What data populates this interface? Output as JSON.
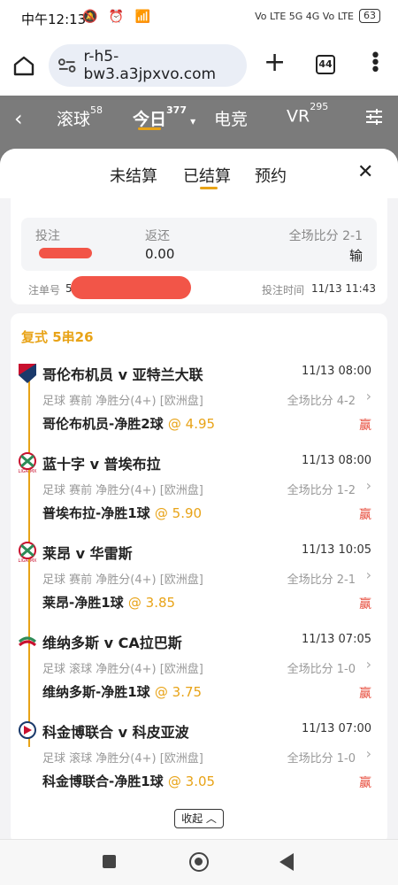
{
  "status_bar": {
    "time": "中午12:13",
    "icons": "🔕 ⏰ 📶",
    "network": "Vo LTE 5G 4G Vo LTE",
    "battery": "63"
  },
  "browser": {
    "url": "r-h5-bw3.a3jpxvo.com",
    "tabs_count": "44",
    "plus": "+",
    "menu": "⋮"
  },
  "app_nav": {
    "back": "‹",
    "items": [
      {
        "label": "滚球",
        "count": "58"
      },
      {
        "label": "今日",
        "count": "377"
      },
      {
        "label": "电竞",
        "count": ""
      },
      {
        "label": "VR",
        "count": "295"
      }
    ]
  },
  "sheet": {
    "tabs": [
      "未结算",
      "已结算",
      "预约"
    ],
    "close": "✕"
  },
  "summary": {
    "bet_label": "投注",
    "return_label": "返还",
    "return_value": "0.00",
    "score_label": "全场比分 2-1",
    "result": "输",
    "order_label": "注单号",
    "order_prefix": "50",
    "bet_time_label": "投注时间",
    "bet_time": "11/13 11:43"
  },
  "detail": {
    "title": "复式 5串26",
    "collapse": "收起 ︿",
    "matches": [
      {
        "teams": "哥伦布机员 v 亚特兰大联",
        "time": "11/13 08:00",
        "info": "足球 赛前   净胜分(4+) [欧洲盘]",
        "score": "全场比分 4-2",
        "pick": "哥伦布机员-净胜2球",
        "odds": "@ 4.95",
        "result": "赢"
      },
      {
        "teams": "蓝十字 v 普埃布拉",
        "time": "11/13 08:00",
        "info": "足球 赛前   净胜分(4+) [欧洲盘]",
        "score": "全场比分 1-2",
        "pick": "普埃布拉-净胜1球",
        "odds": "@ 5.90",
        "result": "赢"
      },
      {
        "teams": "莱昂 v 华雷斯",
        "time": "11/13 10:05",
        "info": "足球 赛前   净胜分(4+) [欧洲盘]",
        "score": "全场比分 2-1",
        "pick": "莱昂-净胜1球",
        "odds": "@ 3.85",
        "result": "赢"
      },
      {
        "teams": "维纳多斯 v CA拉巴斯",
        "time": "11/13 07:05",
        "info": "足球 滚球   净胜分(4+) [欧洲盘]",
        "score": "全场比分 1-0",
        "pick": "维纳多斯-净胜1球",
        "odds": "@ 3.75",
        "result": "赢"
      },
      {
        "teams": "科金博联合 v 科皮亚波",
        "time": "11/13 07:00",
        "info": "足球 滚球   净胜分(4+) [欧洲盘]",
        "score": "全场比分 1-0",
        "pick": "科金博联合-净胜1球",
        "odds": "@ 3.05",
        "result": "赢"
      }
    ]
  },
  "colors": {
    "accent": "#e8a317",
    "win": "#e74c3c",
    "redact": "#f25548"
  }
}
